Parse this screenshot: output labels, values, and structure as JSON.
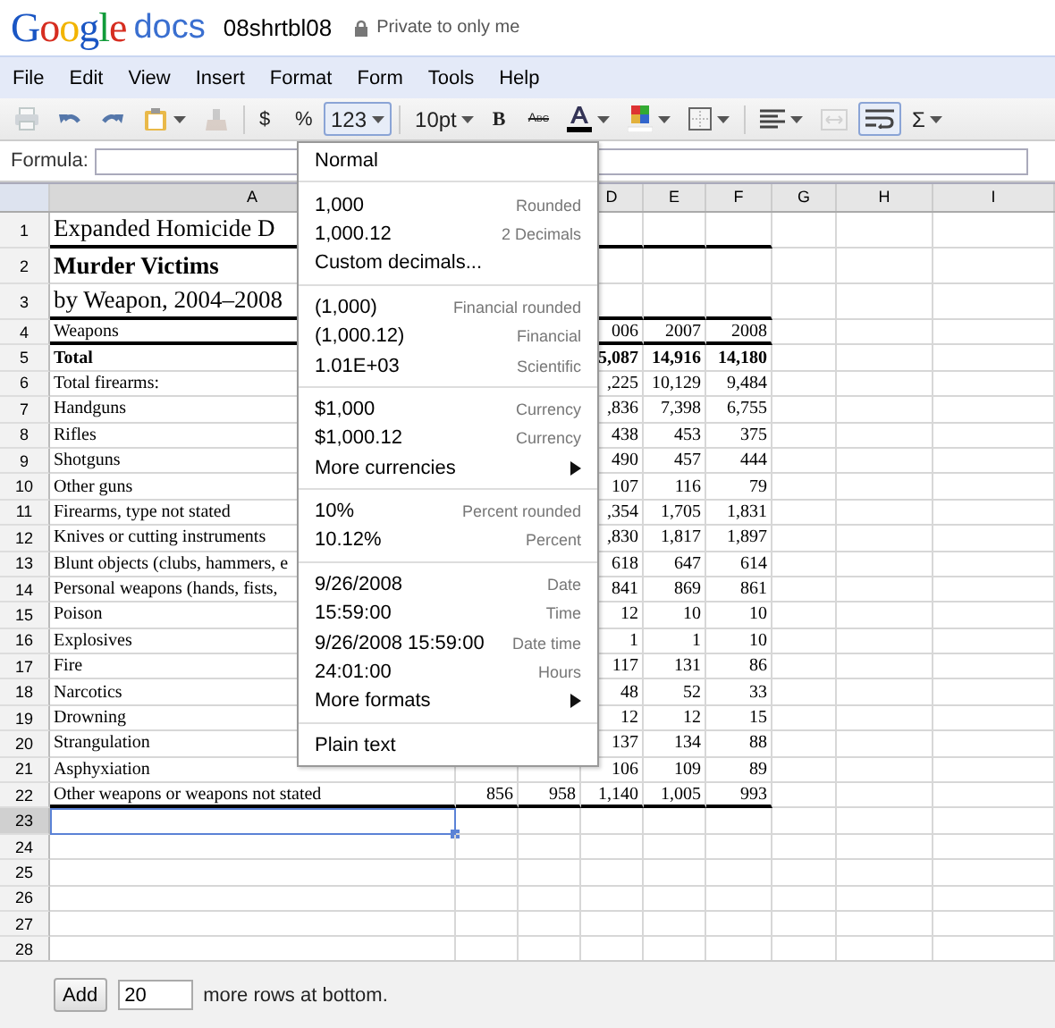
{
  "header": {
    "brand": "Google",
    "product": "docs",
    "doc_title": "08shrtbl08",
    "sharing": "Private to only me"
  },
  "menubar": [
    "File",
    "Edit",
    "View",
    "Insert",
    "Format",
    "Form",
    "Tools",
    "Help"
  ],
  "toolbar": [
    {
      "kind": "print",
      "pressed": false,
      "disabled": true
    },
    {
      "kind": "undo",
      "pressed": false,
      "disabled": false
    },
    {
      "kind": "redo",
      "pressed": false,
      "disabled": false
    },
    {
      "kind": "paste",
      "pressed": false,
      "disabled": false
    },
    {
      "kind": "eraser",
      "pressed": false,
      "disabled": true
    },
    {
      "kind": "sep"
    },
    {
      "kind": "symbol",
      "label": "$",
      "pressed": false,
      "disabled": false
    },
    {
      "kind": "symbol",
      "label": "%",
      "pressed": false,
      "disabled": false
    },
    {
      "kind": "dropdown",
      "label": "123",
      "pressed": true,
      "disabled": false
    },
    {
      "kind": "sep"
    },
    {
      "kind": "dropdown",
      "label": "10pt",
      "pressed": false,
      "disabled": false
    },
    {
      "kind": "bold",
      "label": "B",
      "pressed": false,
      "disabled": false
    },
    {
      "kind": "strike",
      "label": "Abc",
      "pressed": false,
      "disabled": false
    },
    {
      "kind": "text-color",
      "pressed": false,
      "disabled": false
    },
    {
      "kind": "fill-color",
      "pressed": false,
      "disabled": false
    },
    {
      "kind": "borders",
      "pressed": false,
      "disabled": false
    },
    {
      "kind": "sep"
    },
    {
      "kind": "align",
      "pressed": false,
      "disabled": false
    },
    {
      "kind": "merge",
      "pressed": false,
      "disabled": true
    },
    {
      "kind": "wrap",
      "pressed": true,
      "disabled": false
    },
    {
      "kind": "dropdown",
      "label": "Σ",
      "pressed": false,
      "disabled": false
    }
  ],
  "formula_bar": {
    "label": "Formula:"
  },
  "columns": [
    "A",
    "D",
    "E",
    "F",
    "G",
    "H",
    "I"
  ],
  "rows": [
    {
      "number": "1",
      "kind": "heading",
      "bold": false,
      "underline": true,
      "selected": false,
      "cells": [
        "Expanded Homicide D"
      ]
    },
    {
      "number": "2",
      "kind": "heading",
      "bold": true,
      "underline": false,
      "selected": false,
      "cells": [
        "Murder Victims"
      ]
    },
    {
      "number": "3",
      "kind": "heading",
      "bold": false,
      "underline": true,
      "selected": false,
      "cells": [
        "by Weapon, 2004–2008"
      ]
    },
    {
      "number": "4",
      "kind": "data",
      "bold": false,
      "underline": true,
      "selected": false,
      "cells": [
        "Weapons",
        null,
        null,
        "006",
        "2007",
        "2008"
      ]
    },
    {
      "number": "5",
      "kind": "data",
      "bold": true,
      "underline": false,
      "selected": false,
      "cells": [
        "Total",
        null,
        null,
        "5,087",
        "14,916",
        "14,180"
      ]
    },
    {
      "number": "6",
      "kind": "data",
      "bold": false,
      "underline": false,
      "selected": false,
      "cells": [
        "Total firearms:",
        null,
        null,
        ",225",
        "10,129",
        "9,484"
      ]
    },
    {
      "number": "7",
      "kind": "data",
      "bold": false,
      "underline": false,
      "selected": false,
      "cells": [
        "Handguns",
        null,
        null,
        ",836",
        "7,398",
        "6,755"
      ]
    },
    {
      "number": "8",
      "kind": "data",
      "bold": false,
      "underline": false,
      "selected": false,
      "cells": [
        "Rifles",
        null,
        null,
        "438",
        "453",
        "375"
      ]
    },
    {
      "number": "9",
      "kind": "data",
      "bold": false,
      "underline": false,
      "selected": false,
      "cells": [
        "Shotguns",
        null,
        null,
        "490",
        "457",
        "444"
      ]
    },
    {
      "number": "10",
      "kind": "data",
      "bold": false,
      "underline": false,
      "selected": false,
      "cells": [
        "Other guns",
        null,
        null,
        "107",
        "116",
        "79"
      ]
    },
    {
      "number": "11",
      "kind": "data",
      "bold": false,
      "underline": false,
      "selected": false,
      "cells": [
        "Firearms, type not stated",
        null,
        null,
        ",354",
        "1,705",
        "1,831"
      ]
    },
    {
      "number": "12",
      "kind": "data",
      "bold": false,
      "underline": false,
      "selected": false,
      "cells": [
        "Knives or cutting instruments",
        null,
        null,
        ",830",
        "1,817",
        "1,897"
      ]
    },
    {
      "number": "13",
      "kind": "data",
      "bold": false,
      "underline": false,
      "selected": false,
      "cells": [
        "Blunt objects (clubs, hammers, e",
        null,
        null,
        "618",
        "647",
        "614"
      ]
    },
    {
      "number": "14",
      "kind": "data",
      "bold": false,
      "underline": false,
      "selected": false,
      "cells": [
        "Personal weapons (hands, fists,",
        null,
        null,
        "841",
        "869",
        "861"
      ]
    },
    {
      "number": "15",
      "kind": "data",
      "bold": false,
      "underline": false,
      "selected": false,
      "cells": [
        "Poison",
        null,
        null,
        "12",
        "10",
        "10"
      ]
    },
    {
      "number": "16",
      "kind": "data",
      "bold": false,
      "underline": false,
      "selected": false,
      "cells": [
        "Explosives",
        null,
        null,
        "1",
        "1",
        "10"
      ]
    },
    {
      "number": "17",
      "kind": "data",
      "bold": false,
      "underline": false,
      "selected": false,
      "cells": [
        "Fire",
        null,
        null,
        "117",
        "131",
        "86"
      ]
    },
    {
      "number": "18",
      "kind": "data",
      "bold": false,
      "underline": false,
      "selected": false,
      "cells": [
        "Narcotics",
        null,
        null,
        "48",
        "52",
        "33"
      ]
    },
    {
      "number": "19",
      "kind": "data",
      "bold": false,
      "underline": false,
      "selected": false,
      "cells": [
        "Drowning",
        null,
        null,
        "12",
        "12",
        "15"
      ]
    },
    {
      "number": "20",
      "kind": "data",
      "bold": false,
      "underline": false,
      "selected": false,
      "cells": [
        "Strangulation",
        null,
        null,
        "137",
        "134",
        "88"
      ]
    },
    {
      "number": "21",
      "kind": "data",
      "bold": false,
      "underline": false,
      "selected": false,
      "cells": [
        "Asphyxiation",
        null,
        null,
        "106",
        "109",
        "89"
      ]
    },
    {
      "number": "22",
      "kind": "data",
      "bold": false,
      "underline": true,
      "selected": false,
      "cells": [
        "Other weapons or weapons not stated",
        "856",
        "958",
        "1,140",
        "1,005",
        "993"
      ]
    },
    {
      "number": "23",
      "kind": "data",
      "selected": true
    },
    {
      "number": "24",
      "kind": "data",
      "selected": false
    },
    {
      "number": "25",
      "kind": "data",
      "selected": false
    },
    {
      "number": "26",
      "kind": "data",
      "selected": false
    },
    {
      "number": "27",
      "kind": "data",
      "selected": false
    },
    {
      "number": "28",
      "kind": "data",
      "selected": false
    }
  ],
  "format_menu": [
    [
      {
        "label": "Normal",
        "submenu": false
      }
    ],
    [
      {
        "label": "1,000",
        "hint": "Rounded",
        "submenu": false
      },
      {
        "label": "1,000.12",
        "hint": "2 Decimals",
        "submenu": false
      },
      {
        "label": "Custom decimals...",
        "submenu": false
      }
    ],
    [
      {
        "label": "(1,000)",
        "hint": "Financial rounded",
        "submenu": false
      },
      {
        "label": "(1,000.12)",
        "hint": "Financial",
        "submenu": false
      },
      {
        "label": "1.01E+03",
        "hint": "Scientific",
        "submenu": false
      }
    ],
    [
      {
        "label": "$1,000",
        "hint": "Currency",
        "submenu": false
      },
      {
        "label": "$1,000.12",
        "hint": "Currency",
        "submenu": false
      },
      {
        "label": "More currencies",
        "submenu": true
      }
    ],
    [
      {
        "label": "10%",
        "hint": "Percent rounded",
        "submenu": false
      },
      {
        "label": "10.12%",
        "hint": "Percent",
        "submenu": false
      }
    ],
    [
      {
        "label": "9/26/2008",
        "hint": "Date",
        "submenu": false
      },
      {
        "label": "15:59:00",
        "hint": "Time",
        "submenu": false
      },
      {
        "label": "9/26/2008 15:59:00",
        "hint": "Date time",
        "submenu": false
      },
      {
        "label": "24:01:00",
        "hint": "Hours",
        "submenu": false
      },
      {
        "label": "More formats",
        "submenu": true
      }
    ],
    [
      {
        "label": "Plain text",
        "submenu": false
      }
    ]
  ],
  "footer": {
    "button": "Add",
    "value": "20",
    "text": "more rows at bottom."
  }
}
